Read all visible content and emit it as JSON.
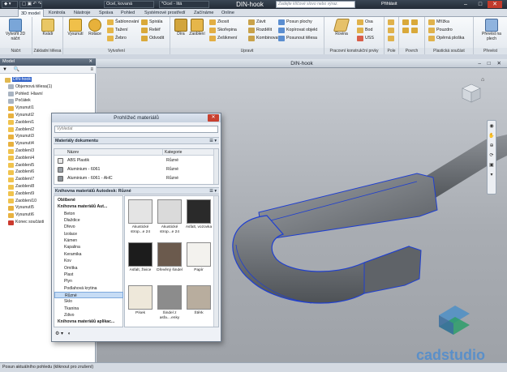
{
  "titlebar": {
    "material": "Ocel, kovaná",
    "appearance": "*Ocel - litá",
    "title": "DIN-hook",
    "search_placeholder": "Zadejte klíčové slovo nebo výraz.",
    "login": "Přihlásit"
  },
  "menu": {
    "tabs": [
      "3D model",
      "Kontrola",
      "Nástroje",
      "Správa",
      "Pohled",
      "Systémové prostředí",
      "Začínáme",
      "Online"
    ]
  },
  "ribbon": {
    "sketch": {
      "start_label": "Vytvořit 2D náčrt",
      "panel": "Náčrt"
    },
    "basic": {
      "box_label": "Kvádr",
      "panel": "Základní tělesa"
    },
    "create": {
      "extrude": "Vysunutí",
      "revolve": "Rotace",
      "loft": "Šablonování",
      "sweep": "Tažení",
      "rib": "Žebro",
      "coil": "Spirála",
      "emboss": "Reliéf",
      "derive": "Odvodit",
      "panel": "Vytvoření"
    },
    "modify": {
      "hole": "Díra",
      "fillet": "Zaoblení",
      "chamfer": "Zkosit",
      "shell": "Skořepina",
      "draft": "Zešikmení",
      "thread": "Závit",
      "split": "Rozdělit",
      "combine": "Kombinovat",
      "move_face": "Posun plochy",
      "copy_object": "Kopírovat objekt",
      "move_bodies": "Posunout tělesa",
      "panel": "Upravit"
    },
    "work": {
      "plane": "Rovina",
      "axis": "Osa",
      "point": "Bod",
      "ucs": "USS",
      "panel": "Pracovní konstrukční prvky"
    },
    "pattern": {
      "panel": "Pole"
    },
    "surface": {
      "panel": "Povrch"
    },
    "plastic": {
      "grill": "Mřížka",
      "boss": "Pouzdro",
      "rest": "Opěrná ploška",
      "panel": "Plastická součást"
    },
    "convert": {
      "label": "Převést na plech",
      "panel": "Převést"
    }
  },
  "browser": {
    "title": "Model",
    "items": [
      "DIN-hook",
      "Objemová tělesa(1)",
      "Pohled: Hlavní",
      "Počátek",
      "Vysunutí1",
      "Vysunutí2",
      "Zaoblení1",
      "Zaoblení2",
      "Vysunutí3",
      "Vysunutí4",
      "Zaoblení3",
      "Zaoblení4",
      "Zaoblení5",
      "Zaoblení6",
      "Zaoblení7",
      "Zaoblení8",
      "Zaoblení9",
      "Zaoblení10",
      "Vysunutí5",
      "Vysunutí6",
      "Konec součásti"
    ]
  },
  "viewport": {
    "title": "DIN-hook"
  },
  "dialog": {
    "title": "Prohlížeč materiálů",
    "search_placeholder": "Vyhledat",
    "doc_section": "Materiály dokumentu",
    "col_name": "Název",
    "col_category": "Kategorie",
    "doc_rows": [
      {
        "name": "ABS Plastik",
        "category": "Různé"
      },
      {
        "name": "Aluminium - 6061",
        "category": "Různé"
      },
      {
        "name": "Aluminium - 6061 - AHC",
        "category": "Různé"
      }
    ],
    "lib_section": "Knihovna materiálů Autodesk: Různé",
    "lib_tree": [
      {
        "label": "Oblíbené",
        "group": true
      },
      {
        "label": "Knihovna materiálů Aut...",
        "group": true
      },
      {
        "label": "Beton"
      },
      {
        "label": "Dlaždice"
      },
      {
        "label": "Dřevo"
      },
      {
        "label": "Izolace"
      },
      {
        "label": "Kámen"
      },
      {
        "label": "Kapalina"
      },
      {
        "label": "Keramika"
      },
      {
        "label": "Kov"
      },
      {
        "label": "Omítka"
      },
      {
        "label": "Plast"
      },
      {
        "label": "Plyn"
      },
      {
        "label": "Podlahová krytina"
      },
      {
        "label": "Různé",
        "selected": true
      },
      {
        "label": "Sklo"
      },
      {
        "label": "Tkanina"
      },
      {
        "label": "Zdivo"
      },
      {
        "label": "Knihovna materiálů aplikac...",
        "group": true
      }
    ],
    "tiles": [
      {
        "label": "Akustické strop...e 24",
        "color": "#e4e4e4"
      },
      {
        "label": "Akustické strop...e 24",
        "color": "#dadada"
      },
      {
        "label": "Asfalt, vozovka",
        "color": "#2a2a2a"
      },
      {
        "label": "Asfalt, živice",
        "color": "#1c1c1c"
      },
      {
        "label": "Dřevěný šindel",
        "color": "#6b5a4d"
      },
      {
        "label": "Papír",
        "color": "#f3f2ee"
      },
      {
        "label": "Písek",
        "color": "#eee8da"
      },
      {
        "label": "Šindel z asfa....enky",
        "color": "#8c8c8c"
      },
      {
        "label": "Štěrk",
        "color": "#b8ad9e"
      }
    ]
  },
  "status": {
    "text": "Posun aktuálního pohledu (kliknout pro zrušení)"
  },
  "logo": {
    "text": "cadstudio"
  }
}
